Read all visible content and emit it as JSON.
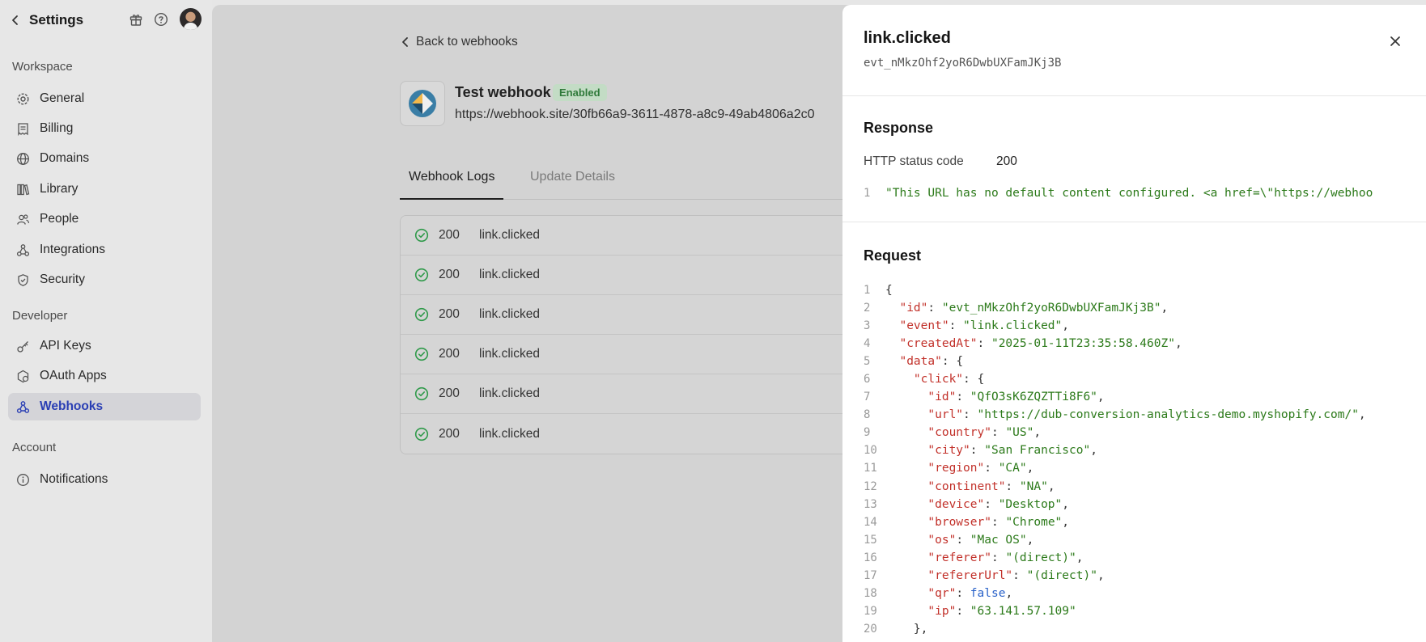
{
  "sidebar": {
    "title": "Settings",
    "sections": [
      {
        "label": "Workspace"
      },
      {
        "label": "Developer"
      },
      {
        "label": "Account"
      }
    ],
    "items": [
      {
        "label": "General",
        "icon": "gear-icon"
      },
      {
        "label": "Billing",
        "icon": "receipt-icon"
      },
      {
        "label": "Domains",
        "icon": "globe-icon"
      },
      {
        "label": "Library",
        "icon": "library-icon"
      },
      {
        "label": "People",
        "icon": "people-icon"
      },
      {
        "label": "Integrations",
        "icon": "integrations-icon"
      },
      {
        "label": "Security",
        "icon": "shield-icon"
      },
      {
        "label": "API Keys",
        "icon": "key-icon"
      },
      {
        "label": "OAuth Apps",
        "icon": "oauth-icon"
      },
      {
        "label": "Webhooks",
        "icon": "webhook-icon",
        "active": true
      },
      {
        "label": "Notifications",
        "icon": "info-icon"
      }
    ]
  },
  "main": {
    "back_label": "Back to webhooks",
    "webhook_name": "Test webhook",
    "status_badge": "Enabled",
    "webhook_url": "https://webhook.site/30fb66a9-3611-4878-a8c9-49ab4806a2c0",
    "tabs": [
      {
        "label": "Webhook Logs"
      },
      {
        "label": "Update Details"
      }
    ],
    "logs": [
      {
        "code": "200",
        "event": "link.clicked"
      },
      {
        "code": "200",
        "event": "link.clicked"
      },
      {
        "code": "200",
        "event": "link.clicked"
      },
      {
        "code": "200",
        "event": "link.clicked"
      },
      {
        "code": "200",
        "event": "link.clicked"
      },
      {
        "code": "200",
        "event": "link.clicked"
      }
    ]
  },
  "panel": {
    "title": "link.clicked",
    "event_id": "evt_nMkzOhf2yoR6DwbUXFamJKj3B",
    "response_heading": "Response",
    "status_label": "HTTP status code",
    "status_value": "200",
    "response_line_no": "1",
    "response_body": "\"This URL has no default content configured. <a href=\\\"https://webhoo",
    "request_heading": "Request",
    "request_lines": [
      {
        "n": "1",
        "indent": "",
        "key": "",
        "sep": "",
        "value": "{",
        "vtype": "p",
        "tail": ""
      },
      {
        "n": "2",
        "indent": "  ",
        "key": "\"id\"",
        "sep": ": ",
        "value": "\"evt_nMkzOhf2yoR6DwbUXFamJKj3B\"",
        "vtype": "s",
        "tail": ","
      },
      {
        "n": "3",
        "indent": "  ",
        "key": "\"event\"",
        "sep": ": ",
        "value": "\"link.clicked\"",
        "vtype": "s",
        "tail": ","
      },
      {
        "n": "4",
        "indent": "  ",
        "key": "\"createdAt\"",
        "sep": ": ",
        "value": "\"2025-01-11T23:35:58.460Z\"",
        "vtype": "s",
        "tail": ","
      },
      {
        "n": "5",
        "indent": "  ",
        "key": "\"data\"",
        "sep": ": ",
        "value": "{",
        "vtype": "p",
        "tail": ""
      },
      {
        "n": "6",
        "indent": "    ",
        "key": "\"click\"",
        "sep": ": ",
        "value": "{",
        "vtype": "p",
        "tail": ""
      },
      {
        "n": "7",
        "indent": "      ",
        "key": "\"id\"",
        "sep": ": ",
        "value": "\"QfO3sK6ZQZTTi8F6\"",
        "vtype": "s",
        "tail": ","
      },
      {
        "n": "8",
        "indent": "      ",
        "key": "\"url\"",
        "sep": ": ",
        "value": "\"https://dub-conversion-analytics-demo.myshopify.com/\"",
        "vtype": "s",
        "tail": ","
      },
      {
        "n": "9",
        "indent": "      ",
        "key": "\"country\"",
        "sep": ": ",
        "value": "\"US\"",
        "vtype": "s",
        "tail": ","
      },
      {
        "n": "10",
        "indent": "      ",
        "key": "\"city\"",
        "sep": ": ",
        "value": "\"San Francisco\"",
        "vtype": "s",
        "tail": ","
      },
      {
        "n": "11",
        "indent": "      ",
        "key": "\"region\"",
        "sep": ": ",
        "value": "\"CA\"",
        "vtype": "s",
        "tail": ","
      },
      {
        "n": "12",
        "indent": "      ",
        "key": "\"continent\"",
        "sep": ": ",
        "value": "\"NA\"",
        "vtype": "s",
        "tail": ","
      },
      {
        "n": "13",
        "indent": "      ",
        "key": "\"device\"",
        "sep": ": ",
        "value": "\"Desktop\"",
        "vtype": "s",
        "tail": ","
      },
      {
        "n": "14",
        "indent": "      ",
        "key": "\"browser\"",
        "sep": ": ",
        "value": "\"Chrome\"",
        "vtype": "s",
        "tail": ","
      },
      {
        "n": "15",
        "indent": "      ",
        "key": "\"os\"",
        "sep": ": ",
        "value": "\"Mac OS\"",
        "vtype": "s",
        "tail": ","
      },
      {
        "n": "16",
        "indent": "      ",
        "key": "\"referer\"",
        "sep": ": ",
        "value": "\"(direct)\"",
        "vtype": "s",
        "tail": ","
      },
      {
        "n": "17",
        "indent": "      ",
        "key": "\"refererUrl\"",
        "sep": ": ",
        "value": "\"(direct)\"",
        "vtype": "s",
        "tail": ","
      },
      {
        "n": "18",
        "indent": "      ",
        "key": "\"qr\"",
        "sep": ": ",
        "value": "false",
        "vtype": "b",
        "tail": ","
      },
      {
        "n": "19",
        "indent": "      ",
        "key": "\"ip\"",
        "sep": ": ",
        "value": "\"63.141.57.109\"",
        "vtype": "s",
        "tail": ""
      },
      {
        "n": "20",
        "indent": "    ",
        "key": "",
        "sep": "",
        "value": "},",
        "vtype": "p",
        "tail": ""
      }
    ]
  },
  "colors": {
    "accent": "#2a3fb4",
    "json_key": "#c2312a",
    "json_string": "#2c7a1a",
    "json_bool": "#2a62c9",
    "success": "#2f9a4a"
  }
}
